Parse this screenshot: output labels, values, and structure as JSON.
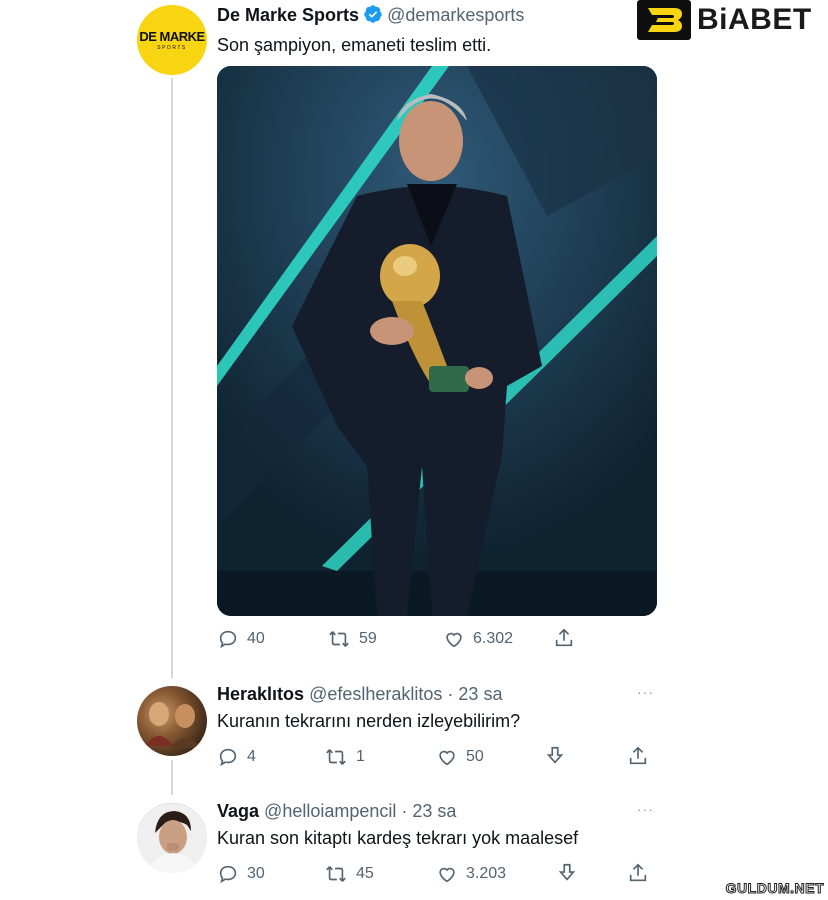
{
  "brand": {
    "name": "BiABET"
  },
  "main_tweet": {
    "name": "De Marke Sports",
    "handle": "@demarkesports",
    "avatar_logo": "DE MARKE",
    "avatar_sub": "SPORTS",
    "text": "Son şampiyon, emaneti teslim etti.",
    "media_alt": "Photo: coach carrying the World Cup trophy on stage",
    "actions": {
      "replies": "40",
      "retweets": "59",
      "likes": "6.302"
    }
  },
  "replies": [
    {
      "name": "Heraklıtos",
      "handle": "@efeslheraklitos",
      "time": "· 23 sa",
      "text": "Kuranın tekrarını nerden izleyebilirim?",
      "actions": {
        "replies": "4",
        "retweets": "1",
        "likes": "50"
      }
    },
    {
      "name": "Vaga",
      "handle": "@helloiampencil",
      "time": "· 23 sa",
      "text": "Kuran son kitaptı kardeş tekrarı yok maalesef",
      "actions": {
        "replies": "30",
        "retweets": "45",
        "likes": "3.203"
      }
    }
  ],
  "more_label": "···",
  "watermark": "GULDUM.NET",
  "colors": {
    "accent_blue": "#1d9bf0",
    "muted": "#536471",
    "brand_yellow": "#f7d513"
  }
}
